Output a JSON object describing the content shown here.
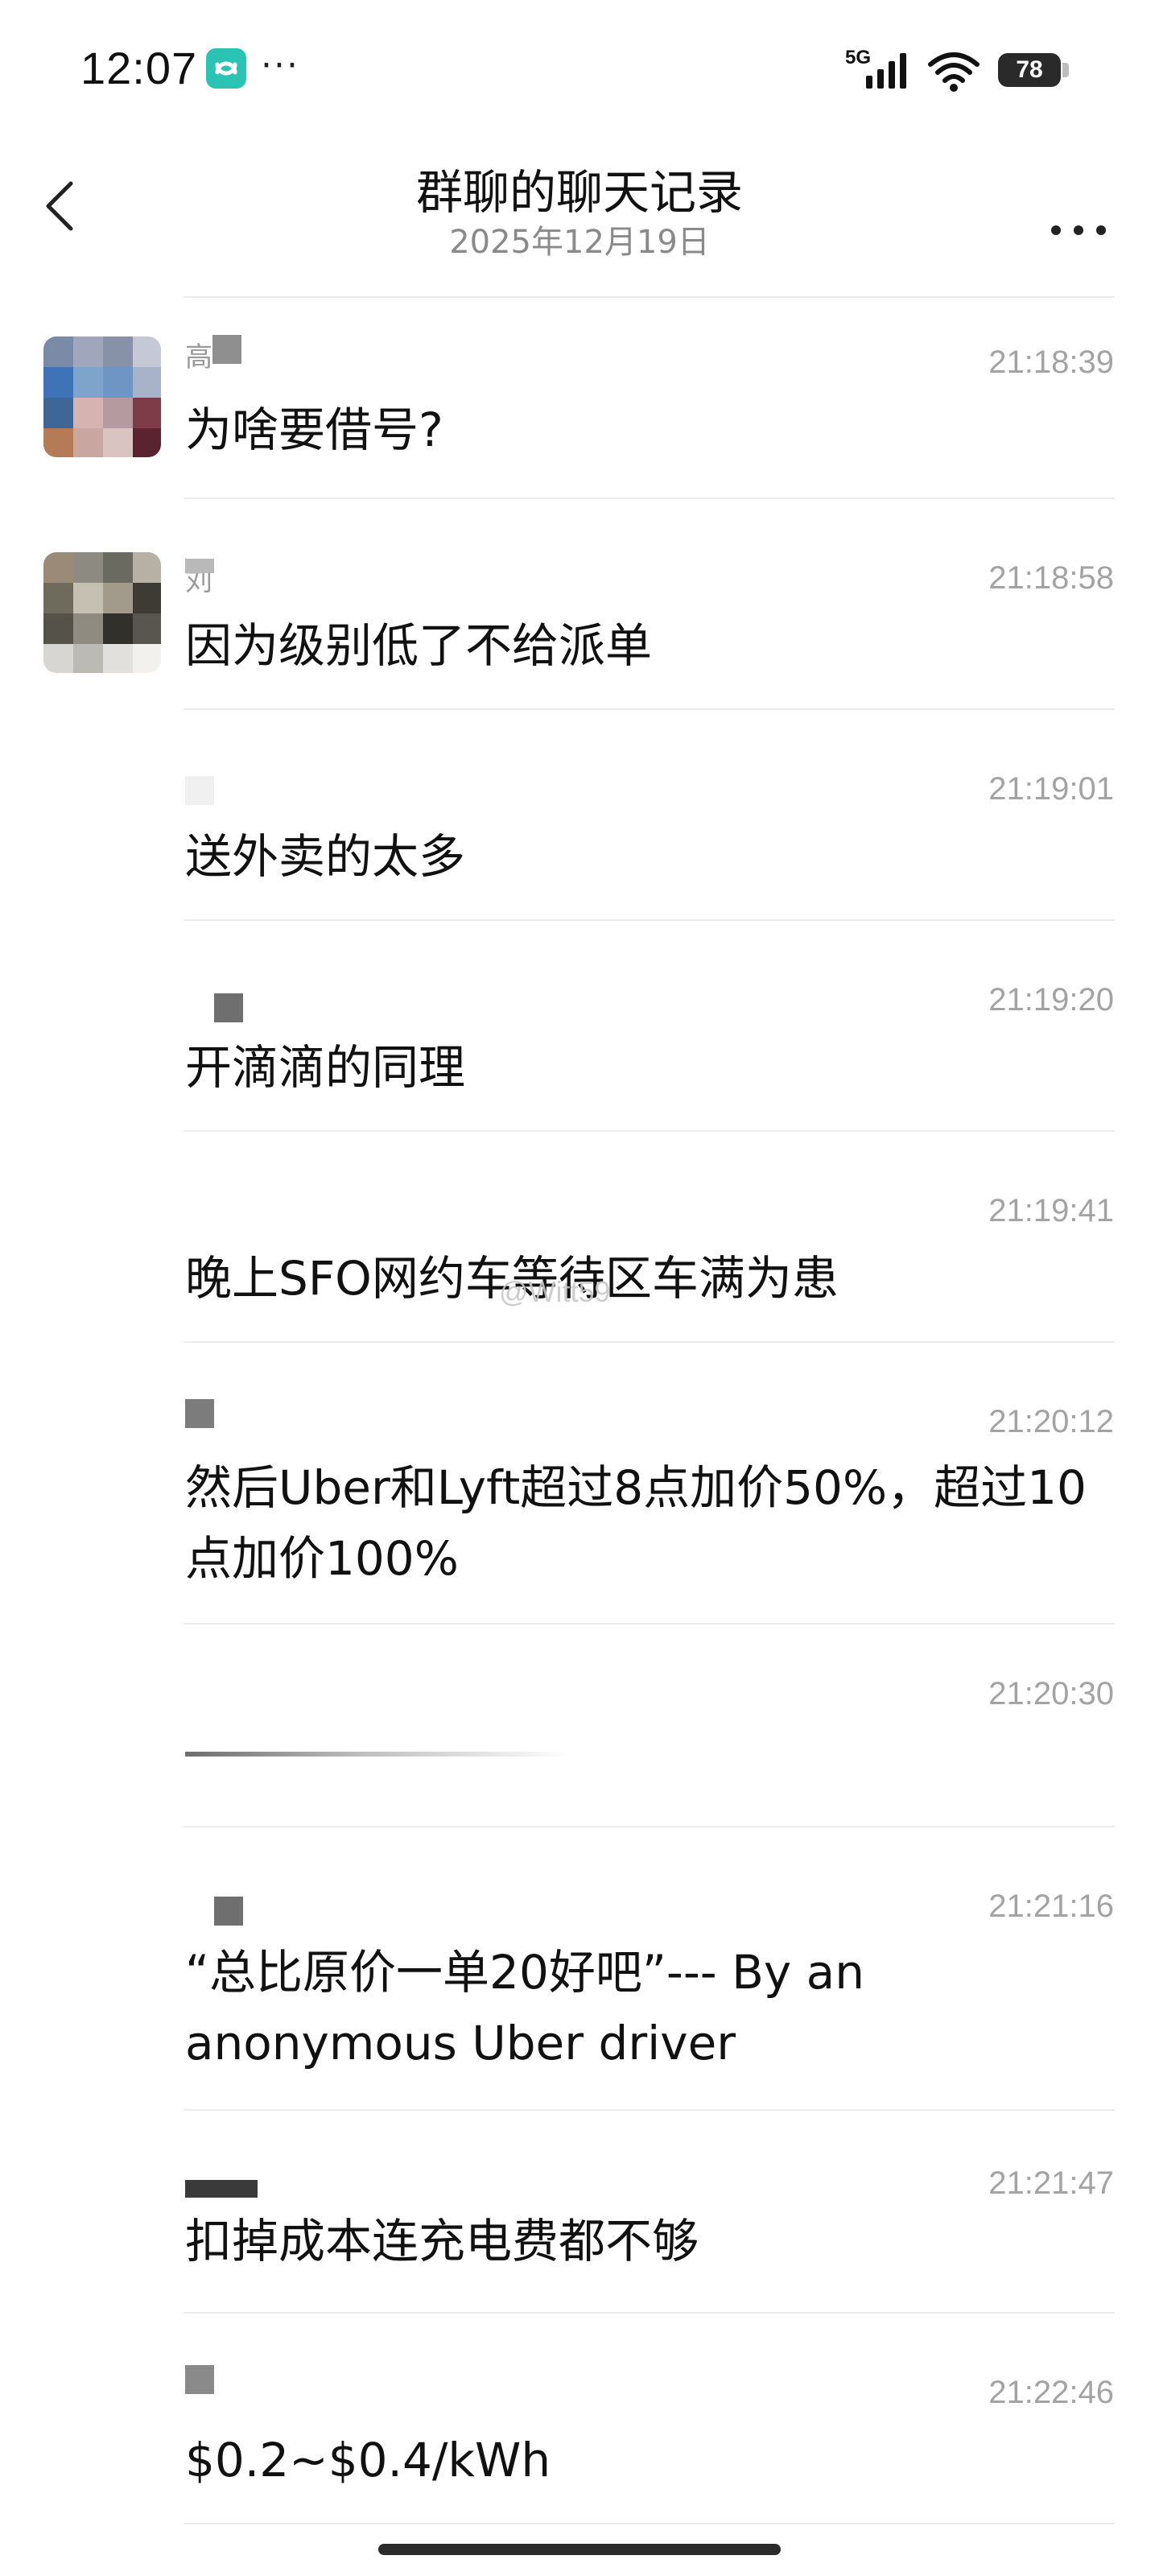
{
  "status_bar": {
    "time": "12:07",
    "dots": "···",
    "network": "5G",
    "battery": "78",
    "app_icon": "app-badge-icon",
    "signal_icon": "cellular-signal-icon",
    "wifi_icon": "wifi-icon",
    "battery_icon": "battery-icon"
  },
  "header": {
    "title": "群聊的聊天记录",
    "subtitle": "2025年12月19日",
    "back_icon": "back-arrow-icon",
    "more_icon": "more-icon"
  },
  "messages": [
    {
      "sender": "高",
      "time": "21:18:39",
      "text": "为啥要借号?",
      "has_avatar": true
    },
    {
      "sender": "刘",
      "time": "21:18:58",
      "text": "因为级别低了不给派单",
      "has_avatar": true
    },
    {
      "sender": "",
      "time": "21:19:01",
      "text": "送外卖的太多",
      "has_avatar": false
    },
    {
      "sender": "",
      "time": "21:19:20",
      "text": "开滴滴的同理",
      "has_avatar": false
    },
    {
      "sender": "",
      "time": "21:19:41",
      "text": "晚上SFO网约车等待区车满为患",
      "has_avatar": false
    },
    {
      "sender": "",
      "time": "21:20:12",
      "text": "然后Uber和Lyft超过8点加价50%，超过10\n点加价100%",
      "has_avatar": false
    },
    {
      "sender": "",
      "time": "21:20:30",
      "text": "",
      "has_avatar": false
    },
    {
      "sender": "",
      "time": "21:21:16",
      "text": "“总比原价一单20好吧”--- By an\nanonymous Uber driver",
      "has_avatar": false
    },
    {
      "sender": "",
      "time": "21:21:47",
      "text": "扣掉成本连充电费都不够",
      "has_avatar": false
    },
    {
      "sender": "",
      "time": "21:22:46",
      "text": "$0.2~$0.4/kWh",
      "has_avatar": false
    }
  ],
  "watermark": "@Witt59",
  "colors": {
    "app_badge": "#2bc3b4",
    "divider": "#ececec",
    "time_text": "#a3a3a3",
    "subtitle_text": "#8a8a8a"
  }
}
